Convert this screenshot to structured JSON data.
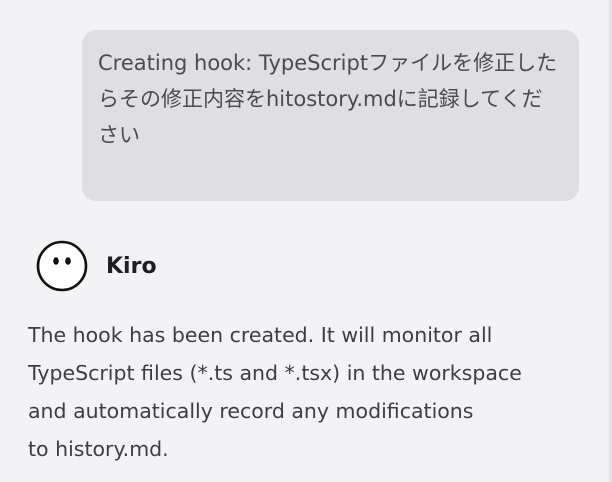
{
  "user_message": {
    "text": "Creating hook: TypeScriptファイルを修正したらその修正内容をhitostory.mdに記録してください"
  },
  "agent": {
    "name": "Kiro",
    "avatar_icon": "ghost-face-icon"
  },
  "agent_message": {
    "line1": "The hook has been created. It will monitor all",
    "line2": "TypeScript files (*.ts and *.tsx) in the workspace",
    "line3": "and automatically record any modifications",
    "line4": "to history.md."
  },
  "colors": {
    "background": "#f3f3f5",
    "user_bubble": "#dfdfe3",
    "text": "#3d3d42"
  }
}
